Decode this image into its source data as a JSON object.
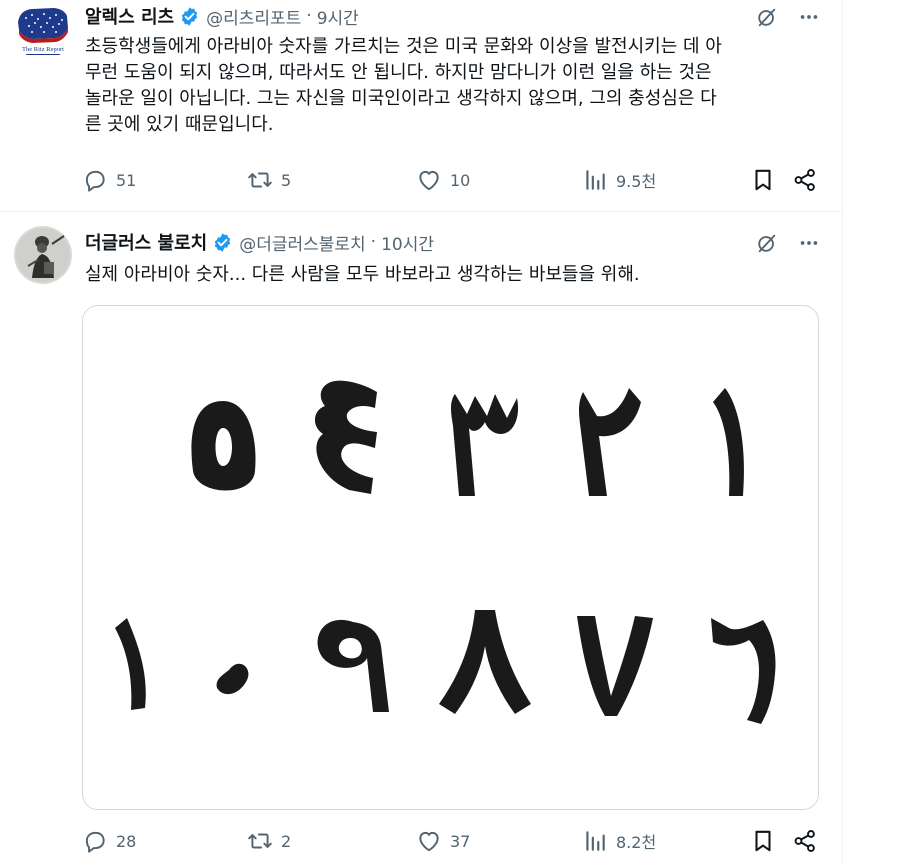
{
  "tweets": [
    {
      "name": "알렉스 리츠",
      "handle": "@리츠리포트",
      "time": "9시간",
      "avatar_label": "The Ritz Report",
      "text": "초등학생들에게 아라비아 숫자를 가르치는 것은 미국 문화와 이상을 발전시키는 데 아\n무런 도움이 되지 않으며, 따라서도 안 됩니다. 하지만 맘다니가 이런 일을 하는 것은\n놀라운 일이 아닙니다. 그는 자신을 미국인이라고 생각하지 않으며, 그의 충성심은 다\n른 곳에 있기 때문입니다.",
      "replies": "51",
      "reposts": "5",
      "likes": "10",
      "views": "9.5천"
    },
    {
      "name": "더글러스 불로치",
      "handle": "@더글러스불로치",
      "time": "10시간",
      "text": "실제 아라비아 숫자... 다른 사람을 모두 바보라고 생각하는 바보들을 위해.",
      "replies": "28",
      "reposts": "2",
      "likes": "37",
      "views": "8.2천",
      "image_numerals_row1": [
        "٥",
        "٤",
        "٣",
        "٢",
        "١"
      ],
      "image_numerals_row2": [
        "١٠",
        "٩",
        "٨",
        "٧",
        "٦"
      ]
    }
  ],
  "icons": {
    "verified": "verified-badge-icon",
    "grok": "grok-icon",
    "more": "more-icon",
    "reply": "reply-icon",
    "repost": "repost-icon",
    "like": "like-icon",
    "views": "views-icon",
    "bookmark": "bookmark-icon",
    "share": "share-icon"
  },
  "colors": {
    "verified": "#1d9bf0",
    "secondary_text": "#536471",
    "border": "#cfd9de"
  }
}
